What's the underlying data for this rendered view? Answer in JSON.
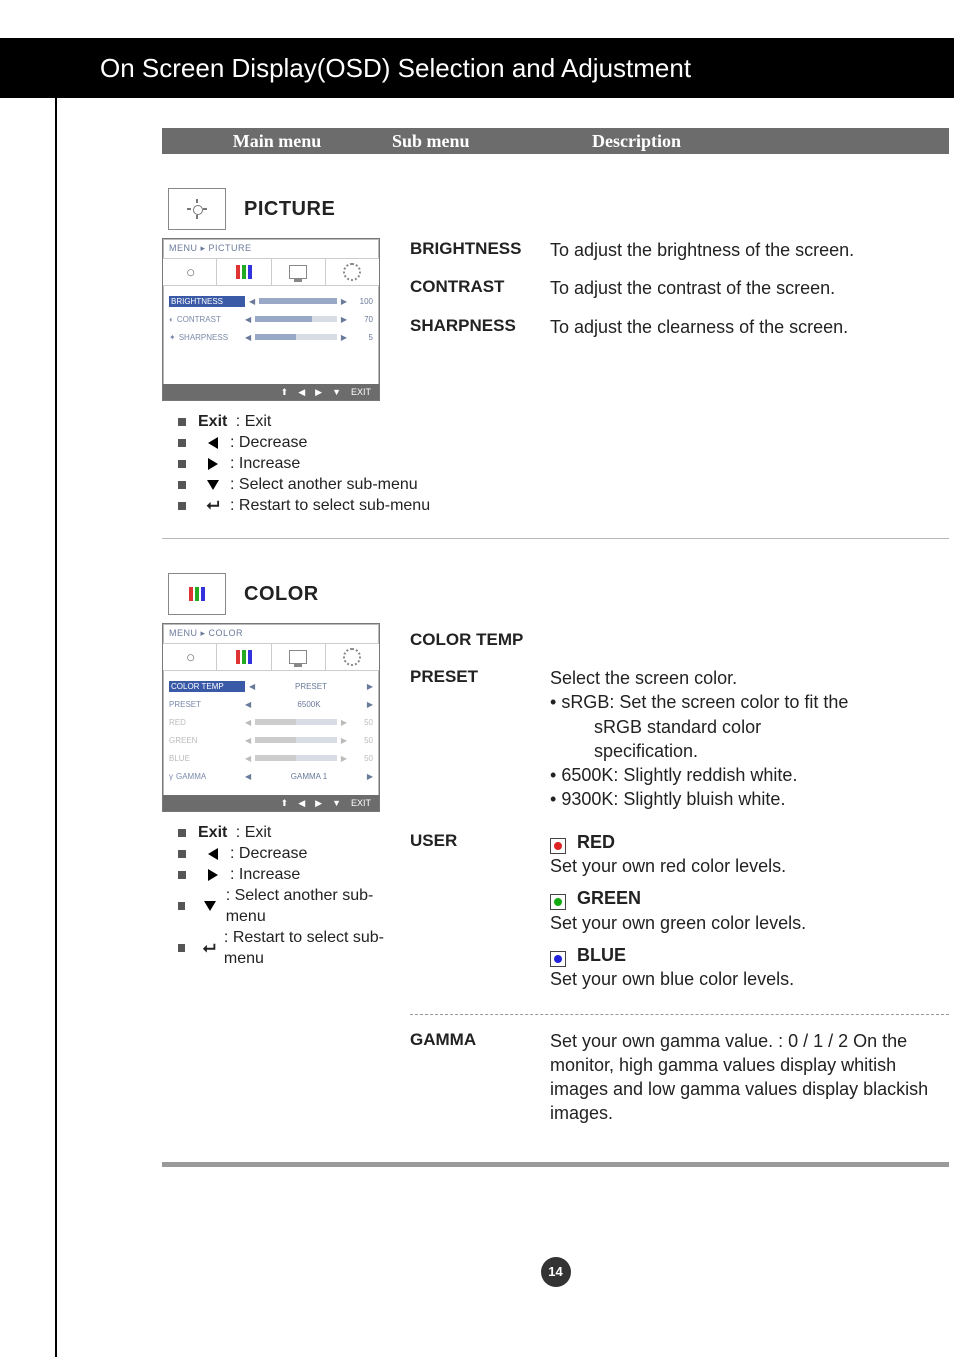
{
  "header": {
    "title": "On Screen Display(OSD) Selection and Adjustment"
  },
  "columns": {
    "main": "Main menu",
    "sub": "Sub menu",
    "desc": "Description"
  },
  "picture": {
    "title": "PICTURE",
    "osd": {
      "breadcrumb": "MENU ▸ PICTURE",
      "items": [
        {
          "label": "BRIGHTNESS",
          "value": 100,
          "selected": true
        },
        {
          "label": "CONTRAST",
          "value": 70,
          "selected": false
        },
        {
          "label": "SHARPNESS",
          "value": 5,
          "selected": false
        }
      ],
      "foot": [
        "⬆",
        "◀",
        "▶",
        "▼",
        "EXIT"
      ]
    },
    "subs": [
      {
        "name": "BRIGHTNESS",
        "desc": "To adjust the brightness of the screen."
      },
      {
        "name": "CONTRAST",
        "desc": "To adjust the contrast of the screen."
      },
      {
        "name": "SHARPNESS",
        "desc": "To adjust the clearness of the screen."
      }
    ]
  },
  "legend": {
    "exit_label": "Exit",
    "exit_desc": ": Exit",
    "decrease": ": Decrease",
    "increase": ": Increase",
    "select": ": Select another sub-menu",
    "restart": ": Restart to select sub-menu"
  },
  "color": {
    "title": "COLOR",
    "osd": {
      "breadcrumb": "MENU ▸ COLOR",
      "items": {
        "colortemp": {
          "label": "COLOR TEMP",
          "value": "PRESET",
          "selected": true
        },
        "preset": {
          "label": "PRESET",
          "value": "6500K"
        },
        "red": {
          "label": "RED",
          "value": 50
        },
        "green": {
          "label": "GREEN",
          "value": 50
        },
        "blue": {
          "label": "BLUE",
          "value": 50
        },
        "gamma": {
          "label": "GAMMA",
          "value": "GAMMA 1"
        }
      },
      "foot": [
        "⬆",
        "◀",
        "▶",
        "▼",
        "EXIT"
      ]
    },
    "group_title": "COLOR TEMP",
    "preset": {
      "name": "PRESET",
      "lead": "Select the screen color.",
      "srgb_a": "sRGB: Set the screen color to fit the",
      "srgb_b": "sRGB standard color",
      "srgb_c": "specification.",
      "k6500": "6500K: Slightly reddish white.",
      "k9300": "9300K: Slightly bluish white."
    },
    "user": {
      "name": "USER",
      "red_t": "RED",
      "red_d": "Set your own red color levels.",
      "green_t": "GREEN",
      "green_d": "Set your own green color levels.",
      "blue_t": "BLUE",
      "blue_d": "Set your own blue color levels."
    },
    "gamma": {
      "name": "GAMMA",
      "desc": "Set your own gamma value. : 0 / 1 / 2 On the monitor, high gamma values display whitish images and low gamma values display blackish images."
    }
  },
  "page_number": "14"
}
